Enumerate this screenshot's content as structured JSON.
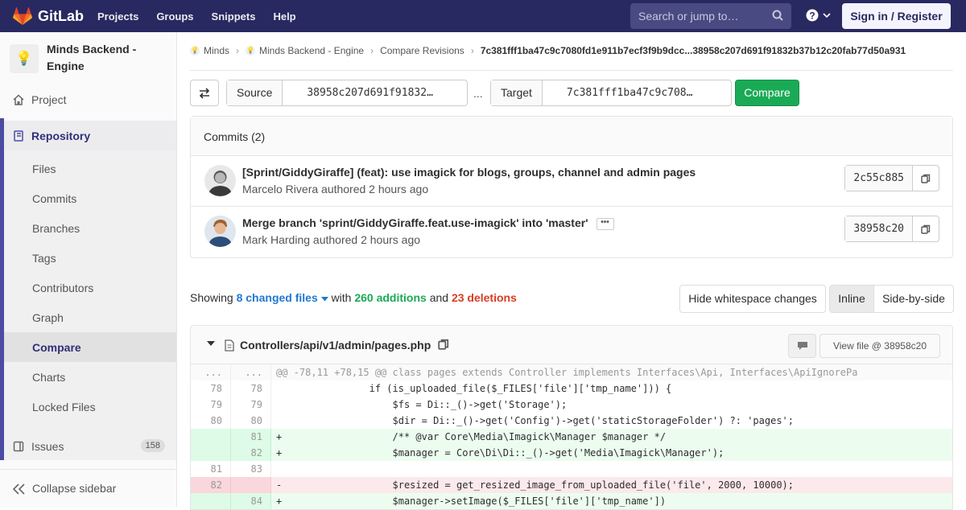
{
  "navbar": {
    "brand": "GitLab",
    "links": [
      "Projects",
      "Groups",
      "Snippets",
      "Help"
    ],
    "search_placeholder": "Search or jump to…",
    "signin": "Sign in / Register"
  },
  "sidebar": {
    "project_name": "Minds Backend - Engine",
    "project": "Project",
    "repository": "Repository",
    "subitems": [
      "Files",
      "Commits",
      "Branches",
      "Tags",
      "Contributors",
      "Graph",
      "Compare",
      "Charts",
      "Locked Files"
    ],
    "issues": "Issues",
    "issues_count": "158",
    "collapse": "Collapse sidebar"
  },
  "breadcrumb": {
    "group": "Minds",
    "project": "Minds Backend - Engine",
    "section": "Compare Revisions",
    "current": "7c381fff1ba47c9c7080fd1e911b7ecf3f9b9dcc...38958c207d691f91832b37b12c20fab77d50a931"
  },
  "compare": {
    "source_label": "Source",
    "source_value": "38958c207d691f91832…",
    "separator": "...",
    "target_label": "Target",
    "target_value": "7c381fff1ba47c9c708…",
    "button": "Compare"
  },
  "commits": {
    "header": "Commits (2)",
    "items": [
      {
        "title": "[Sprint/GiddyGiraffe] (feat): use imagick for blogs, groups, channel and admin pages",
        "author": "Marcelo Rivera authored 2 hours ago",
        "sha": "2c55c885"
      },
      {
        "title": "Merge branch 'sprint/GiddyGiraffe.feat.use-imagick' into 'master'",
        "author": "Mark Harding authored 2 hours ago",
        "sha": "38958c20"
      }
    ]
  },
  "stats": {
    "showing": "Showing",
    "files": "8 changed files",
    "with": "with",
    "additions": "260 additions",
    "and": "and",
    "deletions": "23 deletions"
  },
  "view": {
    "hide_ws": "Hide whitespace changes",
    "inline": "Inline",
    "side": "Side-by-side"
  },
  "file": {
    "name": "Controllers/api/v1/admin/pages.php",
    "view_file": "View file @ 38958c20"
  },
  "diff": [
    {
      "type": "hunk",
      "old": "...",
      "new": "...",
      "code": "@@ -78,11 +78,15 @@ class pages extends Controller implements Interfaces\\Api, Interfaces\\ApiIgnorePa"
    },
    {
      "type": "ctx",
      "old": "78",
      "new": "78",
      "code": "                if (is_uploaded_file($_FILES['file']['tmp_name'])) {"
    },
    {
      "type": "ctx",
      "old": "79",
      "new": "79",
      "code": "                    $fs = Di::_()->get('Storage');"
    },
    {
      "type": "ctx",
      "old": "80",
      "new": "80",
      "code": "                    $dir = Di::_()->get('Config')->get('staticStorageFolder') ?: 'pages';"
    },
    {
      "type": "add",
      "old": "",
      "new": "81",
      "code": "+                   /** @var Core\\Media\\Imagick\\Manager $manager */"
    },
    {
      "type": "add",
      "old": "",
      "new": "82",
      "code": "+                   $manager = Core\\Di\\Di::_()->get('Media\\Imagick\\Manager');"
    },
    {
      "type": "ctx",
      "old": "81",
      "new": "83",
      "code": ""
    },
    {
      "type": "del",
      "old": "82",
      "new": "",
      "code": "-                   $resized = get_resized_image_from_uploaded_file('file', 2000, 10000);"
    },
    {
      "type": "add",
      "old": "",
      "new": "84",
      "code": "+                   $manager->setImage($_FILES['file']['tmp_name'])"
    }
  ]
}
